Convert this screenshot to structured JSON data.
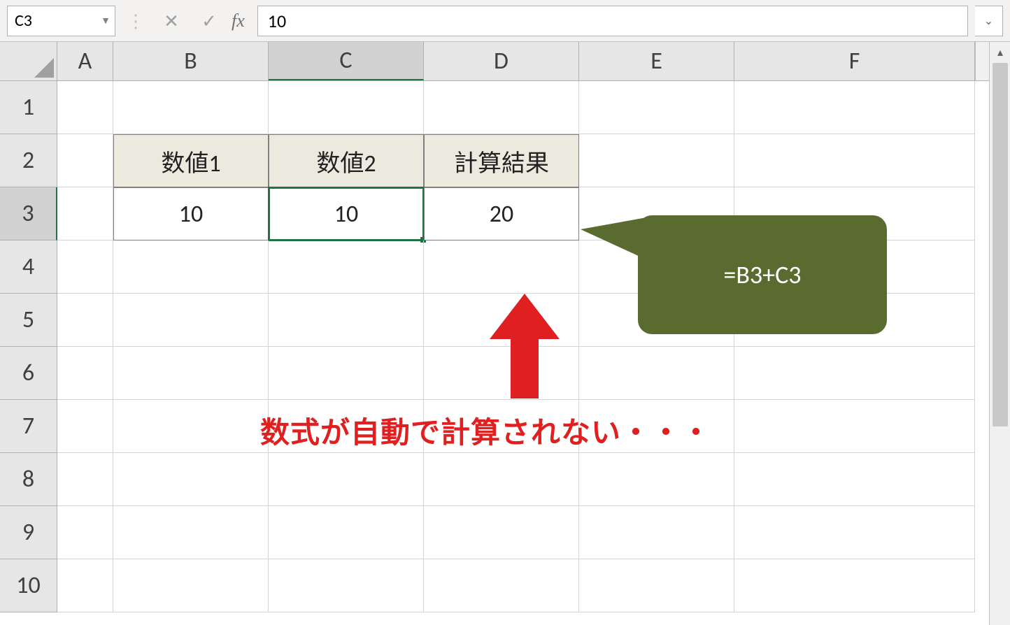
{
  "formula_bar": {
    "cell_ref": "C3",
    "formula_value": "10",
    "fx_label": "fx"
  },
  "columns": [
    "A",
    "B",
    "C",
    "D",
    "E",
    "F"
  ],
  "rows": [
    "1",
    "2",
    "3",
    "4",
    "5",
    "6",
    "7",
    "8",
    "9",
    "10"
  ],
  "selected": {
    "col": "C",
    "row": "3"
  },
  "table": {
    "headers": {
      "b": "数値1",
      "c": "数値2",
      "d": "計算結果"
    },
    "values": {
      "b": "10",
      "c": "10",
      "d": "20"
    }
  },
  "callout": {
    "text": "=B3+C3"
  },
  "note": "数式が自動で計算されない・・・",
  "icons": {
    "cancel": "✕",
    "enter": "✓",
    "dropdown": "▼",
    "expand": "⌄",
    "scroll_up": "▴"
  }
}
